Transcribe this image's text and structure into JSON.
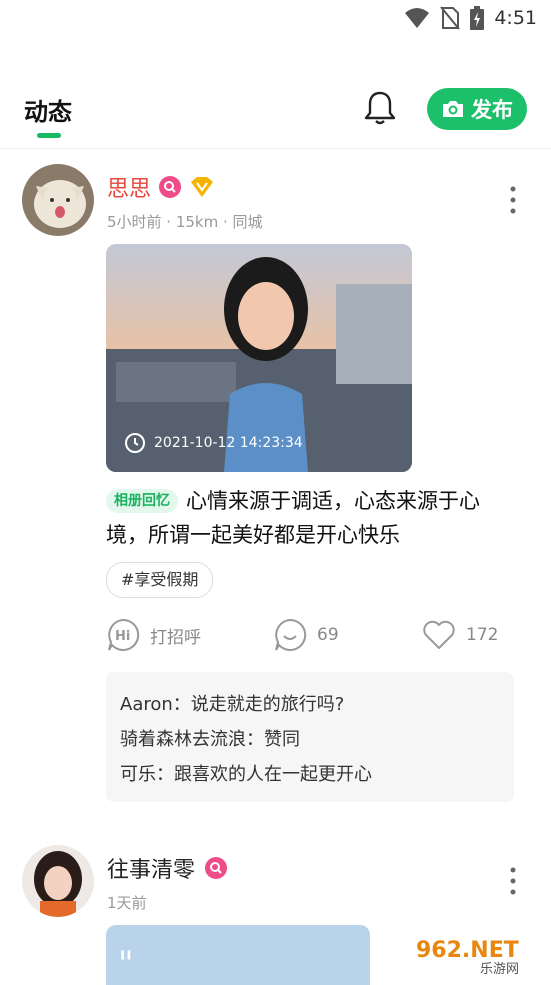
{
  "status_bar": {
    "time": "4:51"
  },
  "header": {
    "tab_title": "动态",
    "publish_label": "发布"
  },
  "posts": [
    {
      "username": "思思",
      "username_color": "#e8483c",
      "meta": "5小时前 · 15km · 同城",
      "photo_timestamp": "2021-10-12  14:23:34",
      "album_tag": "相册回忆",
      "text": "心情来源于调适，心态来源于心境，所谓一起美好都是开心快乐",
      "hashtag": "#享受假期",
      "actions": {
        "greet_label": "打招呼",
        "comment_count": "69",
        "like_count": "172"
      },
      "comments": [
        "Aaron：说走就走的旅行吗?",
        "骑着森林去流浪：赞同",
        "可乐：跟喜欢的人在一起更开心"
      ]
    },
    {
      "username": "往事清零",
      "username_color": "#222222",
      "meta": "1天前"
    }
  ],
  "watermark": {
    "text": "962.NET",
    "subtext": "乐游网"
  },
  "colors": {
    "accent": "#1cc06a",
    "pink_badge": "#ee4d8a",
    "gold_badge": "#f4b400"
  }
}
